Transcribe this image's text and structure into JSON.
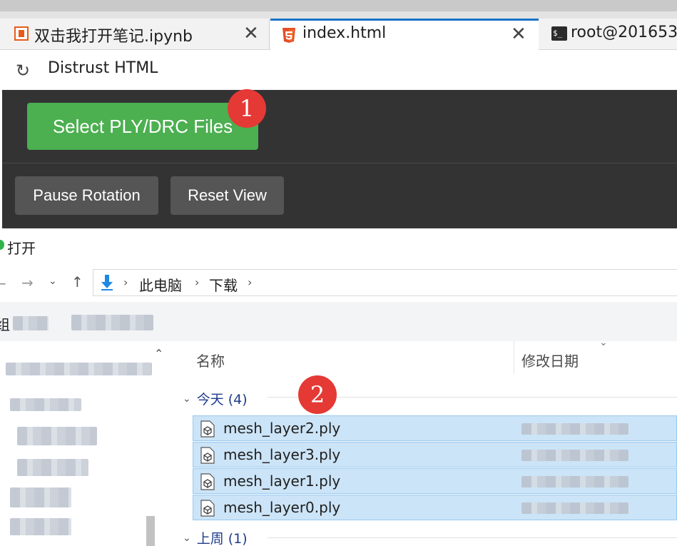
{
  "tabs": [
    {
      "label": "双击我打开笔记.ipynb",
      "icon": "notebook-icon"
    },
    {
      "label": "index.html",
      "icon": "html5-icon",
      "active": true
    },
    {
      "label": "root@201653",
      "icon": "terminal-icon"
    }
  ],
  "tab_close_glyph": "✕",
  "terminal_glyph": "$_",
  "address": {
    "page_title": "Distrust HTML"
  },
  "app": {
    "select_button": "Select PLY/DRC Files",
    "pause_button": "Pause Rotation",
    "reset_button": "Reset View"
  },
  "badges": [
    "1",
    "2"
  ],
  "dialog": {
    "title": "打开",
    "breadcrumb": [
      "此电脑",
      "下载"
    ],
    "toolbar_organize": "组",
    "columns": {
      "name": "名称",
      "date": "修改日期"
    },
    "groups": [
      {
        "label": "今天 (4)"
      },
      {
        "label": "上周 (1)"
      }
    ],
    "files": [
      {
        "name": "mesh_layer2.ply"
      },
      {
        "name": "mesh_layer3.ply"
      },
      {
        "name": "mesh_layer1.ply"
      },
      {
        "name": "mesh_layer0.ply"
      }
    ]
  },
  "colors": {
    "accent_tab": "#1a73c8",
    "select_button": "#4caf50",
    "gray_button": "#555555",
    "app_bg": "#333333",
    "badge": "#e53935",
    "selection": "#cce4f7",
    "group_text": "#1e3b8a"
  }
}
